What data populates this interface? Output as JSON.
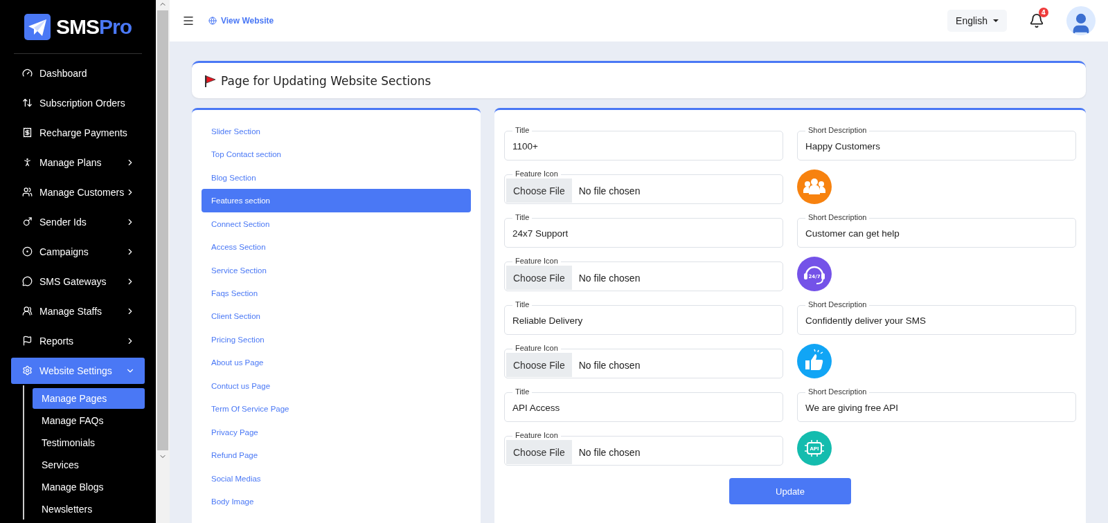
{
  "brand": {
    "name": "SMS",
    "accent": "Pro"
  },
  "sidebar": {
    "items": [
      {
        "label": "Dashboard",
        "submenu": false,
        "selected": false
      },
      {
        "label": "Subscription Orders",
        "submenu": false,
        "selected": false
      },
      {
        "label": "Recharge Payments",
        "submenu": false,
        "selected": false
      },
      {
        "label": "Manage Plans",
        "submenu": true,
        "expanded": false,
        "selected": false
      },
      {
        "label": "Manage Customers",
        "submenu": true,
        "expanded": false,
        "selected": false
      },
      {
        "label": "Sender Ids",
        "submenu": true,
        "expanded": false,
        "selected": false
      },
      {
        "label": "Campaigns",
        "submenu": true,
        "expanded": false,
        "selected": false
      },
      {
        "label": "SMS Gateways",
        "submenu": true,
        "expanded": false,
        "selected": false
      },
      {
        "label": "Manage Staffs",
        "submenu": true,
        "expanded": false,
        "selected": false
      },
      {
        "label": "Reports",
        "submenu": true,
        "expanded": false,
        "selected": false
      },
      {
        "label": "Website Settings",
        "submenu": true,
        "expanded": true,
        "selected": true,
        "children": [
          {
            "label": "Manage Pages",
            "selected": true
          },
          {
            "label": "Manage FAQs",
            "selected": false
          },
          {
            "label": "Testimonials",
            "selected": false
          },
          {
            "label": "Services",
            "selected": false
          },
          {
            "label": "Manage Blogs",
            "selected": false
          },
          {
            "label": "Newsletters",
            "selected": false
          }
        ]
      }
    ]
  },
  "topbar": {
    "view_website": "View Website",
    "language": "English",
    "notifications": "4"
  },
  "page_title": "Page for Updating Website Sections",
  "sections": [
    {
      "label": "Slider Section",
      "selected": false
    },
    {
      "label": "Top Contact section",
      "selected": false
    },
    {
      "label": "Blog Section",
      "selected": false
    },
    {
      "label": "Features section",
      "selected": true
    },
    {
      "label": "Connect Section",
      "selected": false
    },
    {
      "label": "Access Section",
      "selected": false
    },
    {
      "label": "Service Section",
      "selected": false
    },
    {
      "label": "Faqs Section",
      "selected": false
    },
    {
      "label": "Client Section",
      "selected": false
    },
    {
      "label": "Pricing Section",
      "selected": false
    },
    {
      "label": "About us Page",
      "selected": false
    },
    {
      "label": "Contuct us Page",
      "selected": false
    },
    {
      "label": "Term Of Service Page",
      "selected": false
    },
    {
      "label": "Privacy Page",
      "selected": false
    },
    {
      "label": "Refund Page",
      "selected": false
    },
    {
      "label": "Social Medias",
      "selected": false
    },
    {
      "label": "Body Image",
      "selected": false
    }
  ],
  "features": [
    {
      "title_label": "Title",
      "title": "1100+",
      "desc_label": "Short Description",
      "desc": "Happy Customers",
      "icon_label": "Feature Icon",
      "button": "Choose File",
      "file_status": "No file chosen",
      "icon": {
        "kind": "people",
        "color": "#f7820f"
      }
    },
    {
      "title_label": "Title",
      "title": "24x7 Support",
      "desc_label": "Short Description",
      "desc": "Customer can get help",
      "icon_label": "Feature Icon",
      "button": "Choose File",
      "file_status": "No file chosen",
      "icon": {
        "kind": "headset",
        "color": "#7452e8",
        "text": "24/7"
      }
    },
    {
      "title_label": "Title",
      "title": "Reliable Delivery",
      "desc_label": "Short Description",
      "desc": "Confidently deliver your SMS",
      "icon_label": "Feature Icon",
      "button": "Choose File",
      "file_status": "No file chosen",
      "icon": {
        "kind": "thumbs",
        "color": "#11a5f5"
      }
    },
    {
      "title_label": "Title",
      "title": "API Access",
      "desc_label": "Short Description",
      "desc": "We are giving free API",
      "icon_label": "Feature Icon",
      "button": "Choose File",
      "file_status": "No file chosen",
      "icon": {
        "kind": "api",
        "color": "#14bcae",
        "text": "API"
      }
    }
  ],
  "submit": "Update"
}
